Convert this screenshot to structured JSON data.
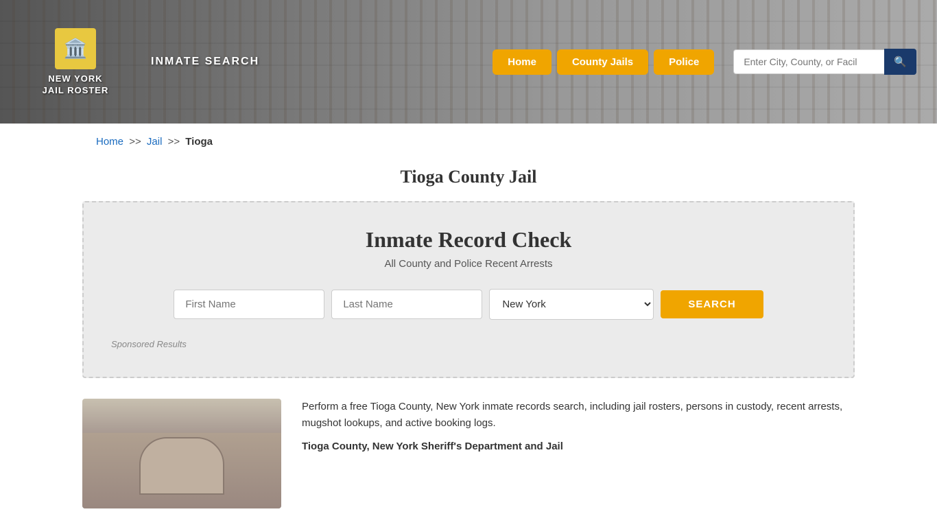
{
  "header": {
    "logo_line1": "NEW YORK",
    "logo_line2": "JAIL ROSTER",
    "inmate_search_label": "INMATE SEARCH",
    "nav": {
      "home": "Home",
      "county_jails": "County Jails",
      "police": "Police"
    },
    "search_placeholder": "Enter City, County, or Facil"
  },
  "breadcrumb": {
    "home": "Home",
    "jail": "Jail",
    "current": "Tioga"
  },
  "page_title": "Tioga County Jail",
  "search_panel": {
    "title": "Inmate Record Check",
    "subtitle": "All County and Police Recent Arrests",
    "first_name_placeholder": "First Name",
    "last_name_placeholder": "Last Name",
    "state_selected": "New York",
    "search_button": "SEARCH",
    "sponsored_label": "Sponsored Results"
  },
  "content": {
    "description1": "Perform a free Tioga County, New York inmate records search, including jail rosters, persons in custody, recent arrests, mugshot lookups, and active booking logs.",
    "description2_prefix": "Tioga County, New York Sheriff's Department and Jail"
  }
}
